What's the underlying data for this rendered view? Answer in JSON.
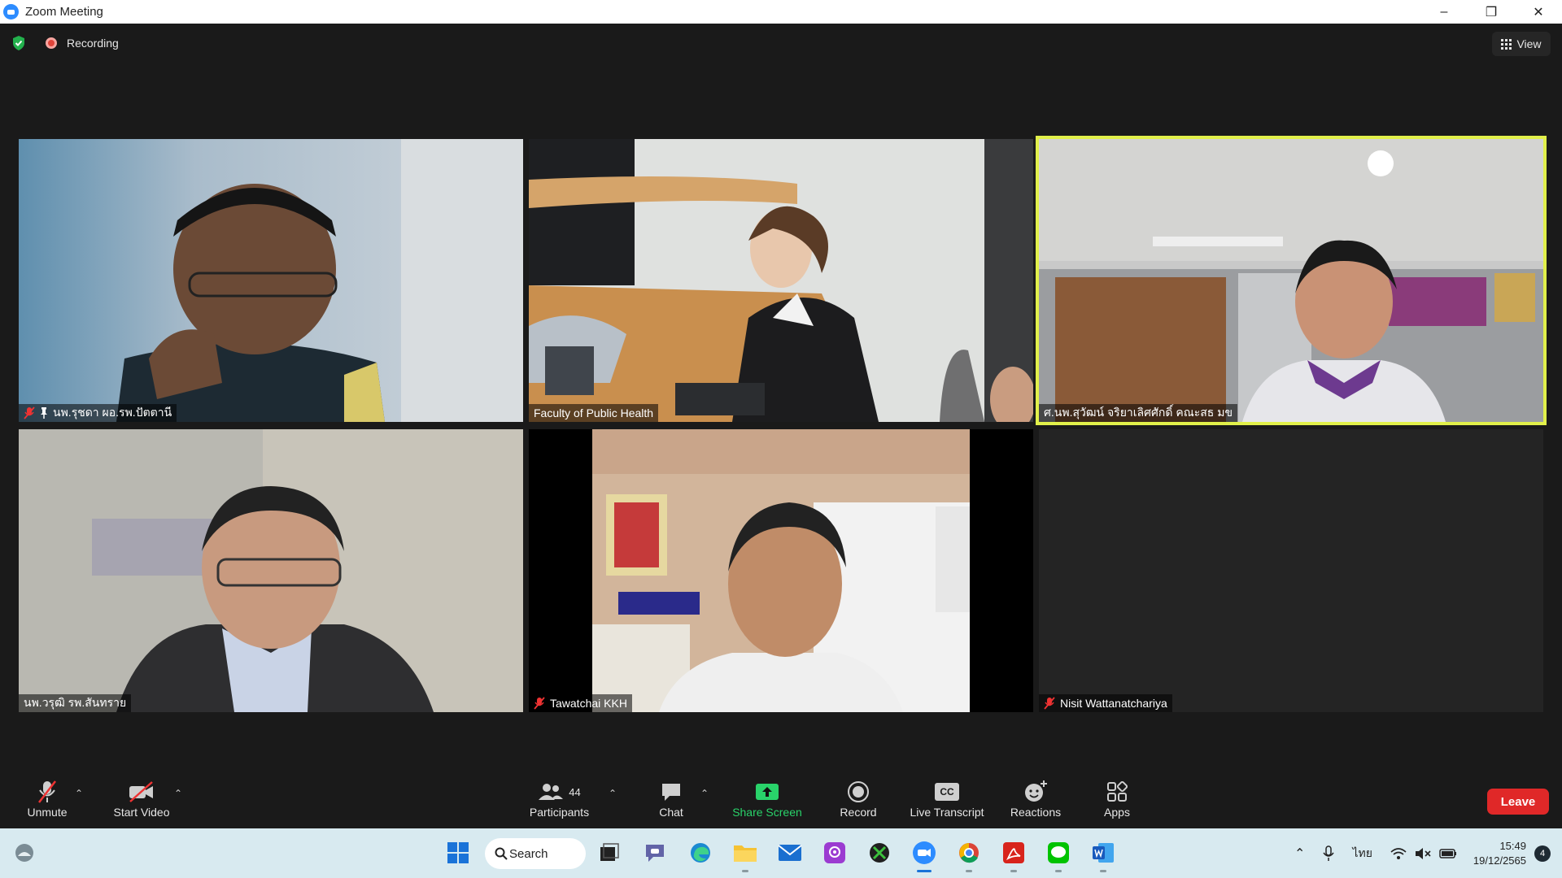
{
  "window": {
    "title": "Zoom Meeting",
    "min": "–",
    "max": "❐",
    "close": "✕"
  },
  "status": {
    "recording_label": "Recording"
  },
  "view": {
    "label": "View"
  },
  "tiles": [
    {
      "name": "นพ.รุชดา ผอ.รพ.ปัตตานี",
      "muted": true,
      "pinned": true,
      "active": false
    },
    {
      "name": "Faculty of Public Health",
      "muted": false,
      "pinned": false,
      "active": false
    },
    {
      "name": "ศ.นพ.สุวัฒน์ จริยาเลิศศักดิ์ คณะสธ มข",
      "muted": false,
      "pinned": false,
      "active": true
    },
    {
      "name": "นพ.วรุฒิ รพ.สันทราย",
      "muted": false,
      "pinned": false,
      "active": false
    },
    {
      "name": "Tawatchai KKH",
      "muted": true,
      "pinned": false,
      "active": false
    },
    {
      "name": "Nisit Wattanatchariya",
      "muted": true,
      "pinned": false,
      "active": false
    }
  ],
  "toolbar": {
    "unmute": "Unmute",
    "start_video": "Start Video",
    "participants": "Participants",
    "participants_count": "44",
    "chat": "Chat",
    "share_screen": "Share Screen",
    "record": "Record",
    "live_transcript": "Live Transcript",
    "cc": "CC",
    "reactions": "Reactions",
    "apps": "Apps",
    "leave": "Leave"
  },
  "taskbar": {
    "search_label": "Search",
    "language": "ไทย",
    "time": "15:49",
    "date": "19/12/2565",
    "notifications": "4"
  },
  "colors": {
    "accent_green": "#29d36a",
    "leave_red": "#e02828",
    "active_border": "#e1f04a",
    "zoom_blue": "#2d8cff"
  }
}
